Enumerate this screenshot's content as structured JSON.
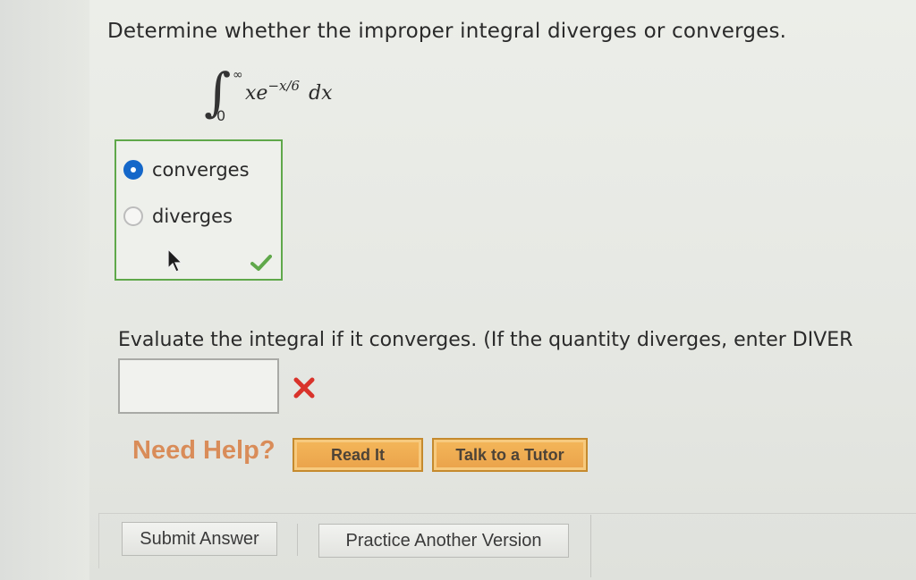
{
  "question": {
    "prompt": "Determine whether the improper integral diverges or converges.",
    "integral": {
      "symbol": "∫",
      "upper_limit": "∞",
      "lower_limit": "0",
      "integrand_base": "xe",
      "integrand_exponent": "−x/6",
      "differential": "dx"
    }
  },
  "choices": {
    "options": [
      {
        "label": "converges",
        "selected": true
      },
      {
        "label": "diverges",
        "selected": false
      }
    ],
    "result": "correct"
  },
  "evaluate": {
    "prompt": "Evaluate the integral if it converges. (If the quantity diverges, enter DIVER",
    "input_value": "",
    "result": "incorrect"
  },
  "help": {
    "label": "Need Help?",
    "read_it": "Read It",
    "talk_to_tutor": "Talk to a Tutor"
  },
  "footer": {
    "submit": "Submit Answer",
    "practice": "Practice Another Version"
  },
  "colors": {
    "correct_border": "#5fa84a",
    "radio_selected": "#1467c9",
    "help_text": "#d98c59",
    "help_button": "#eaa24a",
    "incorrect_mark": "#d9332b"
  }
}
